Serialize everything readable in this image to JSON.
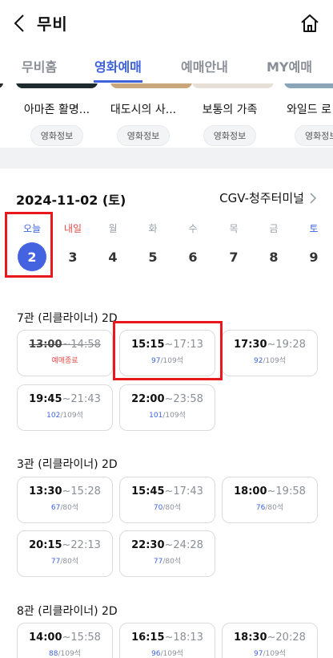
{
  "header": {
    "title": "무비",
    "back_icon": "chevron-left-icon",
    "home_icon": "home-icon"
  },
  "tabs": [
    {
      "label": "무비홈",
      "active": false
    },
    {
      "label": "영화예매",
      "active": true
    },
    {
      "label": "예매안내",
      "active": false
    },
    {
      "label": "MY예매",
      "active": false
    }
  ],
  "movies": [
    {
      "title": "아마존 활명...",
      "info_label": "영화정보"
    },
    {
      "title": "대도시의 사...",
      "info_label": "영화정보"
    },
    {
      "title": "보통의 가족",
      "info_label": "영화정보"
    },
    {
      "title": "와일드 로",
      "info_label": "영화정보"
    }
  ],
  "date": {
    "selected": "2024-11-02 (토)",
    "theater": "CGV-청주터미널"
  },
  "days": [
    {
      "label": "오늘",
      "num": "2"
    },
    {
      "label": "내일",
      "num": "3"
    },
    {
      "label": "월",
      "num": "4"
    },
    {
      "label": "화",
      "num": "5"
    },
    {
      "label": "수",
      "num": "6"
    },
    {
      "label": "목",
      "num": "7"
    },
    {
      "label": "금",
      "num": "8"
    },
    {
      "label": "토",
      "num": "9"
    }
  ],
  "halls": [
    {
      "name": "7관 (리클라이너) 2D",
      "slots": [
        {
          "start": "13:00",
          "end": "~14:58",
          "seats_avail": "",
          "seats_total": "",
          "status": "예매종료"
        },
        {
          "start": "15:15",
          "end": "~17:13",
          "seats_avail": "97",
          "seats_total": "/109석",
          "status": ""
        },
        {
          "start": "17:30",
          "end": "~19:28",
          "seats_avail": "92",
          "seats_total": "/109석",
          "status": ""
        },
        {
          "start": "19:45",
          "end": "~21:43",
          "seats_avail": "102",
          "seats_total": "/109석",
          "status": ""
        },
        {
          "start": "22:00",
          "end": "~23:58",
          "seats_avail": "101",
          "seats_total": "/109석",
          "status": ""
        }
      ]
    },
    {
      "name": "3관 (리클라이너) 2D",
      "slots": [
        {
          "start": "13:30",
          "end": "~15:28",
          "seats_avail": "67",
          "seats_total": "/80석",
          "status": ""
        },
        {
          "start": "15:45",
          "end": "~17:43",
          "seats_avail": "70",
          "seats_total": "/80석",
          "status": ""
        },
        {
          "start": "18:00",
          "end": "~19:58",
          "seats_avail": "76",
          "seats_total": "/80석",
          "status": ""
        },
        {
          "start": "20:15",
          "end": "~22:13",
          "seats_avail": "77",
          "seats_total": "/80석",
          "status": ""
        },
        {
          "start": "22:30",
          "end": "~24:28",
          "seats_avail": "77",
          "seats_total": "/80석",
          "status": ""
        }
      ]
    },
    {
      "name": "8관 (리클라이너) 2D",
      "slots": [
        {
          "start": "14:00",
          "end": "~15:58",
          "seats_avail": "88",
          "seats_total": "/109석",
          "status": ""
        },
        {
          "start": "16:15",
          "end": "~18:13",
          "seats_avail": "96",
          "seats_total": "/109석",
          "status": ""
        },
        {
          "start": "18:30",
          "end": "~20:28",
          "seats_avail": "97",
          "seats_total": "/109석",
          "status": ""
        }
      ]
    }
  ],
  "colors": {
    "accent": "#3e63dd",
    "highlight": "#e8181e",
    "ended": "#e34a4a"
  }
}
